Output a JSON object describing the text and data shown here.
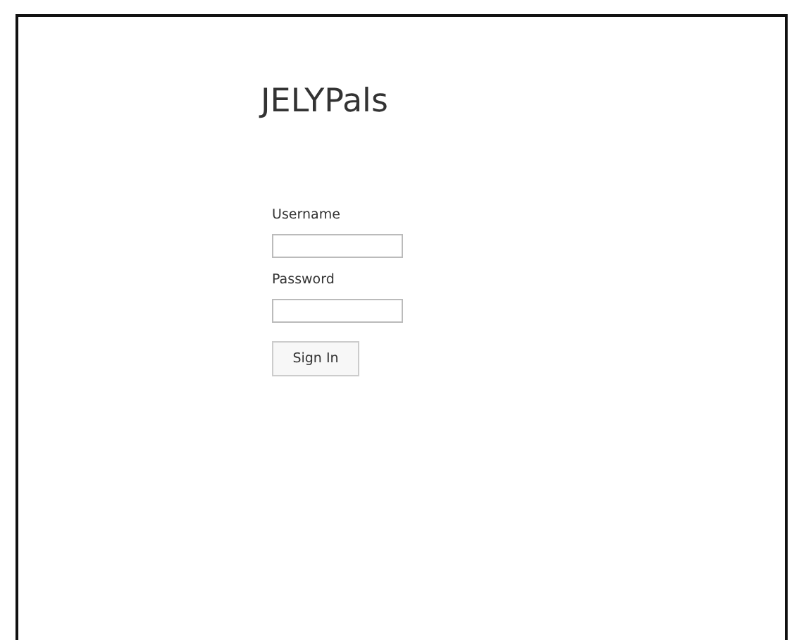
{
  "title": "JELYPals",
  "fields": [
    {
      "label": "Username"
    },
    {
      "label": "Password"
    }
  ],
  "button": "Sign In"
}
